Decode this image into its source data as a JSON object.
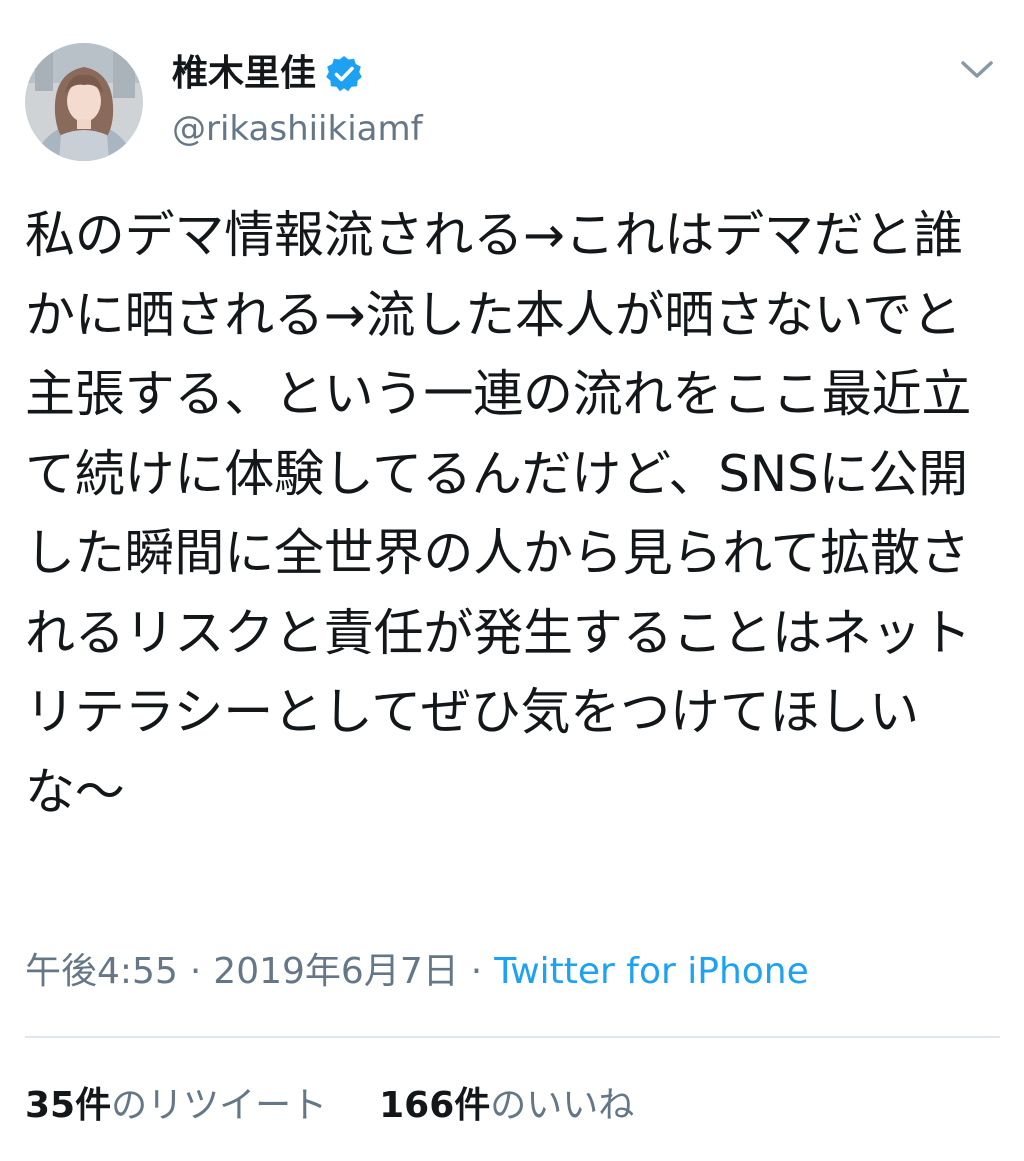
{
  "author": {
    "display_name": "椎木里佳",
    "handle": "@rikashiikiamf",
    "verified": true
  },
  "tweet": {
    "text": "私のデマ情報流される→これはデマだと誰かに晒される→流した本人が晒さないでと主張する、という一連の流れをここ最近立て続けに体験してるんだけど、SNSに公開した瞬間に全世界の人から見られて拡散されるリスクと責任が発生することはネットリテラシーとしてぜひ気をつけてほしいな〜"
  },
  "meta": {
    "time": "午後4:55",
    "separator": "·",
    "date": "2019年6月7日",
    "source": "Twitter for iPhone"
  },
  "stats": {
    "retweets_count": "35件",
    "retweets_label": "のリツイート",
    "likes_count": "166件",
    "likes_label": "のいいね"
  },
  "icons": {
    "avatar": "profile-photo",
    "verified": "verified-badge-icon",
    "menu": "chevron-down-icon"
  },
  "colors": {
    "text": "#14171a",
    "secondary": "#657786",
    "link": "#1da1f2",
    "divider": "#e1e8ed",
    "verified": "#1da1f2"
  }
}
